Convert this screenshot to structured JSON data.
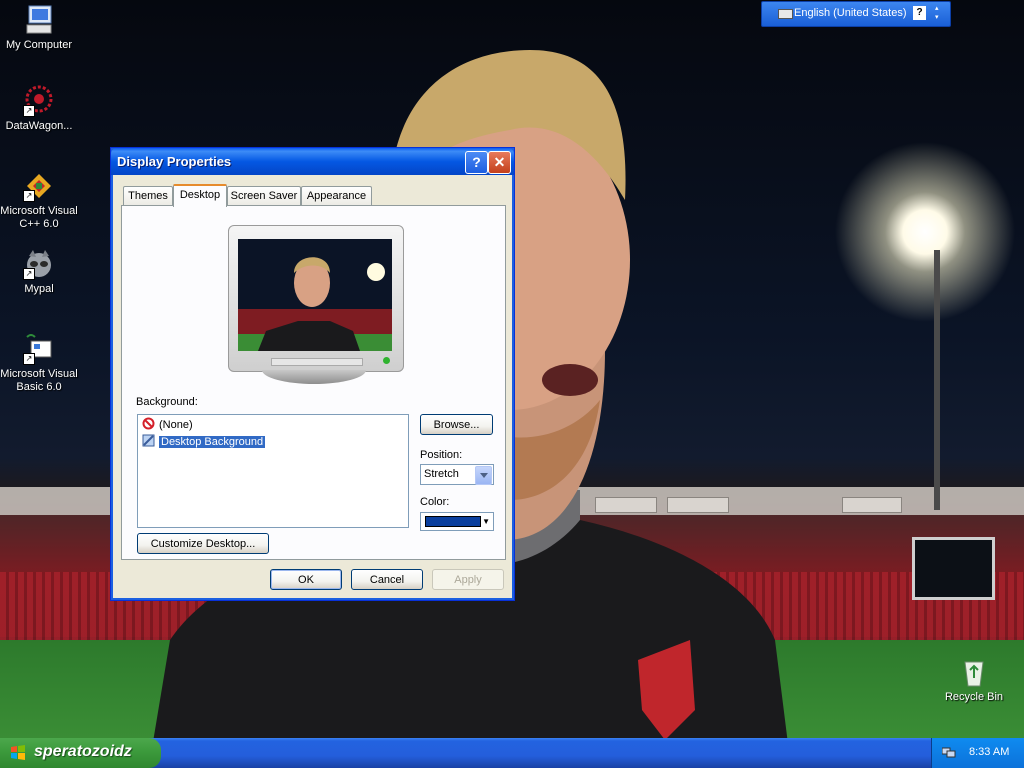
{
  "desktop": {
    "icons": [
      {
        "label": "My Computer"
      },
      {
        "label": "DataWagon..."
      },
      {
        "label_line1": "Microsoft Visual",
        "label_line2": "C++ 6.0"
      },
      {
        "label": "Mypal"
      },
      {
        "label_line1": "Microsoft Visual",
        "label_line2": "Basic 6.0"
      },
      {
        "label": "Recycle Bin"
      }
    ]
  },
  "language_bar": {
    "language": "English (United States)",
    "help_glyph": "?"
  },
  "dialog": {
    "title": "Display Properties",
    "help_glyph": "?",
    "close_glyph": "✕",
    "tabs": [
      {
        "label": "Themes"
      },
      {
        "label": "Desktop",
        "active": true
      },
      {
        "label": "Screen Saver"
      },
      {
        "label": "Appearance"
      }
    ],
    "background_label": "Background:",
    "background_items": [
      {
        "label": "(None)",
        "icon": "none-icon"
      },
      {
        "label": "Desktop Background",
        "icon": "picture-icon",
        "selected": true
      }
    ],
    "browse_label": "Browse...",
    "position_label": "Position:",
    "position_value": "Stretch",
    "color_label": "Color:",
    "color_value": "#0a3f9e",
    "customize_label": "Customize Desktop...",
    "ok_label": "OK",
    "cancel_label": "Cancel",
    "apply_label": "Apply"
  },
  "taskbar": {
    "start_label": "speratozoidz",
    "clock": "8:33 AM"
  },
  "colors": {
    "taskbar_blue": "#245edb",
    "start_green": "#3c9a3c",
    "titlebar_blue": "#0458e3",
    "selection_blue": "#316ac5"
  }
}
